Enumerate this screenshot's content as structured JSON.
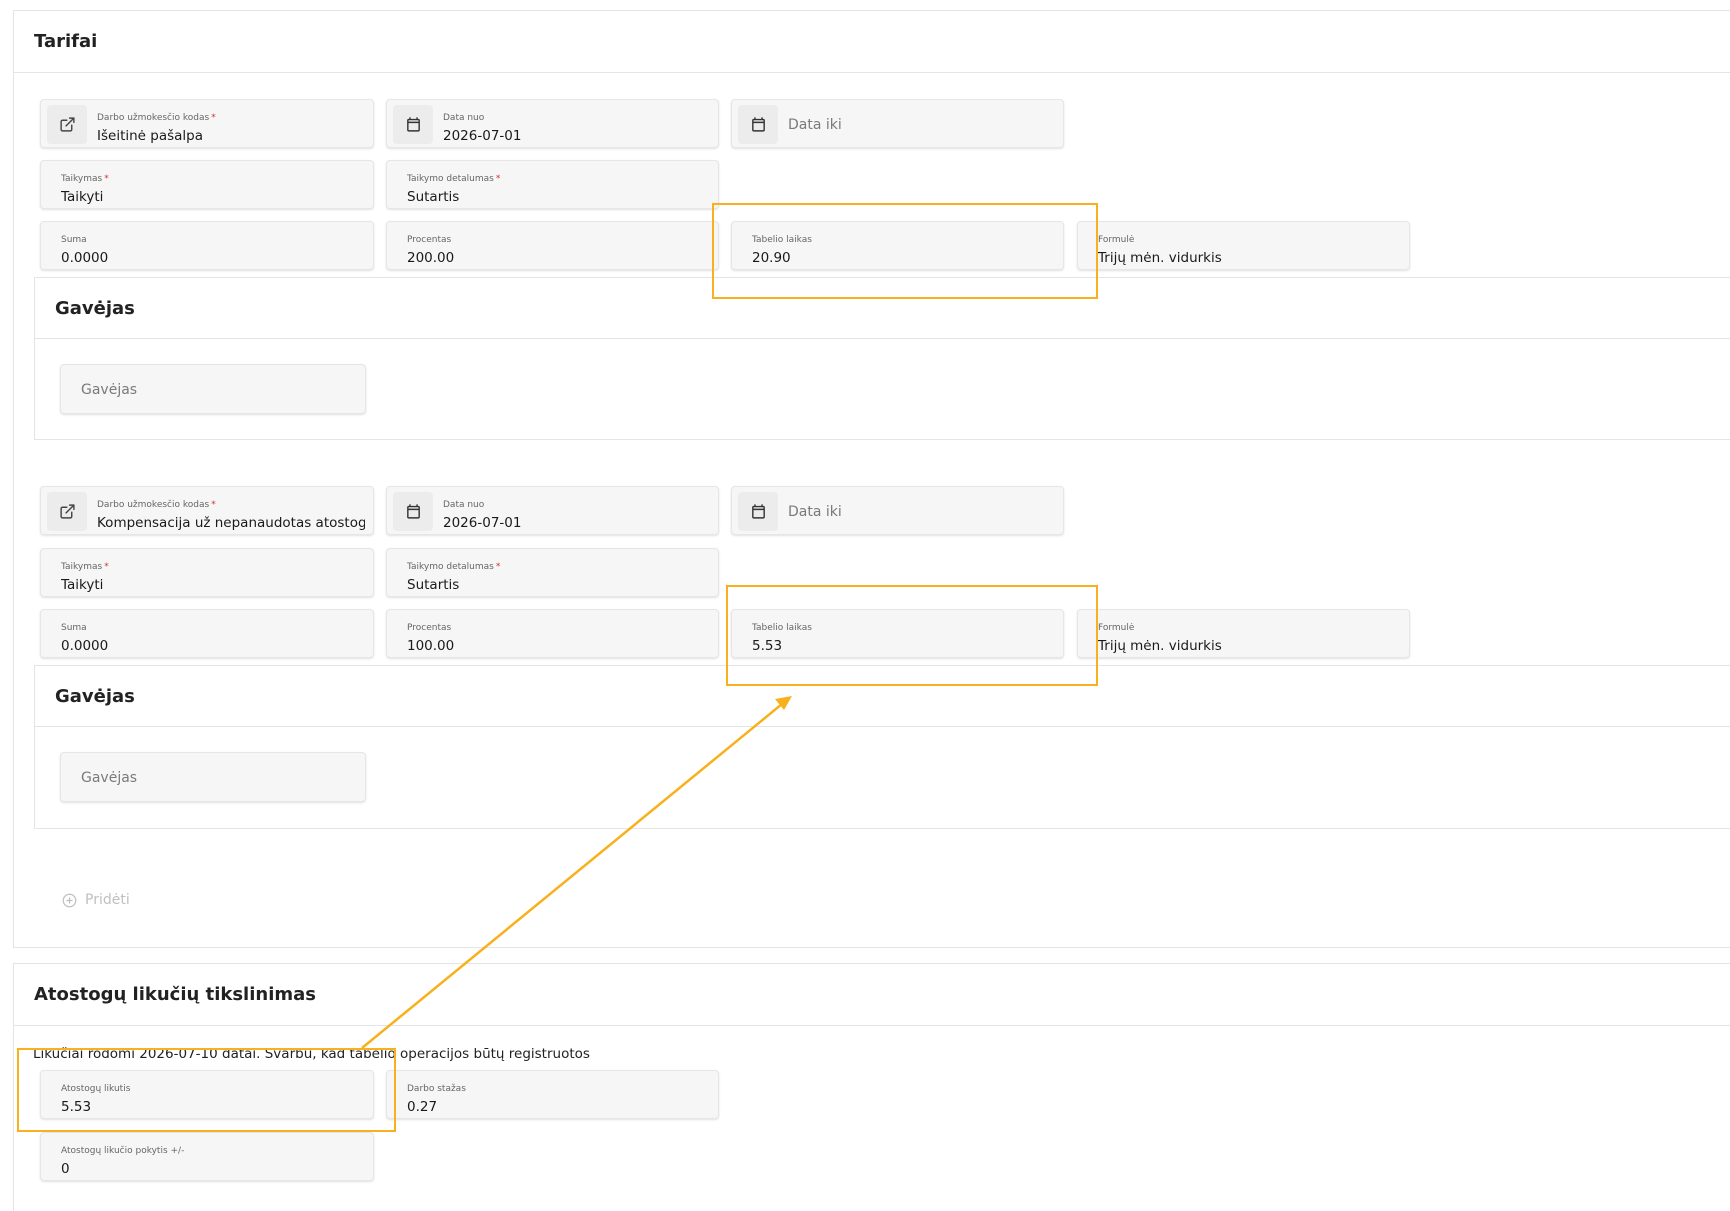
{
  "tarifai": {
    "title": "Tarifai",
    "entries": [
      {
        "code_label": "Darbo užmokesčio kodas",
        "code_value": "Išeitinė pašalpa",
        "date_from_label": "Data nuo",
        "date_from_value": "2026-07-01",
        "date_to_placeholder": "Data iki",
        "taikymas_label": "Taikymas",
        "taikymas_value": "Taikyti",
        "detalumas_label": "Taikymo detalumas",
        "detalumas_value": "Sutartis",
        "suma_label": "Suma",
        "suma_value": "0.0000",
        "procentas_label": "Procentas",
        "procentas_value": "200.00",
        "tabelio_label": "Tabelio laikas",
        "tabelio_value": "20.90",
        "formule_label": "Formulė",
        "formule_value": "Trijų mėn. vidurkis",
        "gavejas_title": "Gavėjas",
        "gavejas_placeholder": "Gavėjas"
      },
      {
        "code_label": "Darbo užmokesčio kodas",
        "code_value": "Kompensacija už nepanaudotas atostoga",
        "date_from_label": "Data nuo",
        "date_from_value": "2026-07-01",
        "date_to_placeholder": "Data iki",
        "taikymas_label": "Taikymas",
        "taikymas_value": "Taikyti",
        "detalumas_label": "Taikymo detalumas",
        "detalumas_value": "Sutartis",
        "suma_label": "Suma",
        "suma_value": "0.0000",
        "procentas_label": "Procentas",
        "procentas_value": "100.00",
        "tabelio_label": "Tabelio laikas",
        "tabelio_value": "5.53",
        "formule_label": "Formulė",
        "formule_value": "Trijų mėn. vidurkis",
        "gavejas_title": "Gavėjas",
        "gavejas_placeholder": "Gavėjas"
      }
    ],
    "add_label": "Pridėti"
  },
  "atostogu": {
    "title": "Atostogų likučių tikslinimas",
    "info": "Likučiai rodomi 2026-07-10 datai. Svarbu, kad tabelio operacijos būtų registruotos",
    "likutis_label": "Atostogų likutis",
    "likutis_value": "5.53",
    "stazas_label": "Darbo stažas",
    "stazas_value": "0.27",
    "pokytis_label": "Atostogų likučio pokytis +/-",
    "pokytis_value": "0"
  },
  "colors": {
    "highlight": "#f8b01c",
    "required": "#d32f2f"
  },
  "icons": {
    "code_field": "external-link-icon",
    "date_fields": "calendar-icon",
    "add_button": "plus-circle-icon"
  }
}
